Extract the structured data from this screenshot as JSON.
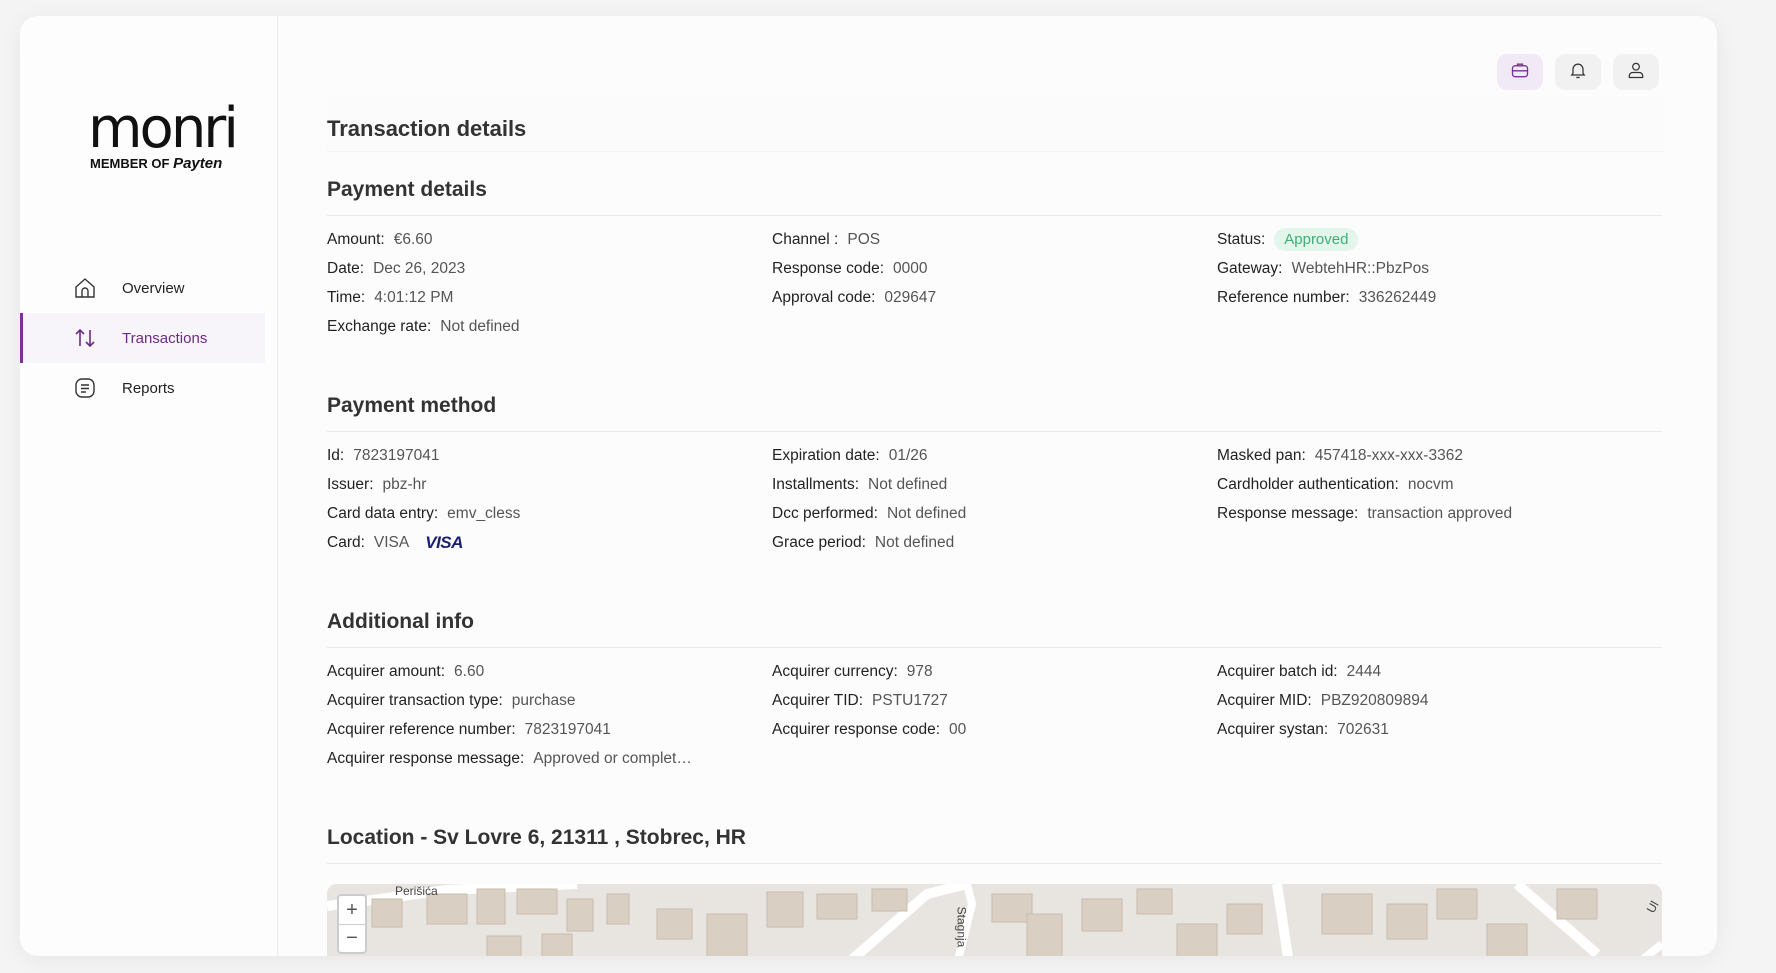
{
  "brand": {
    "logo_text": "monri",
    "member_text": "MEMBER OF",
    "payten_text": "Payten"
  },
  "nav": [
    {
      "label": "Overview",
      "icon": "home-icon"
    },
    {
      "label": "Transactions",
      "icon": "arrows-updown-icon",
      "active": true
    },
    {
      "label": "Reports",
      "icon": "report-icon"
    }
  ],
  "page_title": "Transaction details",
  "payment_details": {
    "title": "Payment details",
    "col1": [
      {
        "label": "Amount:",
        "value": "€6.60"
      },
      {
        "label": "Date:",
        "value": "Dec 26, 2023"
      },
      {
        "label": "Time:",
        "value": "4:01:12 PM"
      },
      {
        "label": "Exchange rate:",
        "value": "Not defined"
      }
    ],
    "col2": [
      {
        "label": "Channel :",
        "value": "POS"
      },
      {
        "label": "Response code:",
        "value": "0000"
      },
      {
        "label": "Approval code:",
        "value": "029647"
      }
    ],
    "col3": [
      {
        "label": "Status:",
        "value": "Approved",
        "badge": true
      },
      {
        "label": "Gateway:",
        "value": "WebtehHR::PbzPos"
      },
      {
        "label": "Reference number:",
        "value": "336262449"
      }
    ]
  },
  "payment_method": {
    "title": "Payment method",
    "col1": [
      {
        "label": "Id:",
        "value": "7823197041"
      },
      {
        "label": "Issuer:",
        "value": "pbz-hr"
      },
      {
        "label": "Card data entry:",
        "value": "emv_cless"
      },
      {
        "label": "Card:",
        "value": "VISA",
        "logo": "VISA"
      }
    ],
    "col2": [
      {
        "label": "Expiration date:",
        "value": "01/26"
      },
      {
        "label": "Installments:",
        "value": "Not defined"
      },
      {
        "label": "Dcc performed:",
        "value": "Not defined"
      },
      {
        "label": "Grace period:",
        "value": "Not defined"
      }
    ],
    "col3": [
      {
        "label": "Masked pan:",
        "value": "457418-xxx-xxx-3362"
      },
      {
        "label": "Cardholder authentication:",
        "value": "nocvm"
      },
      {
        "label": "Response message:",
        "value": "transaction approved"
      }
    ]
  },
  "additional_info": {
    "title": "Additional info",
    "col1": [
      {
        "label": "Acquirer amount:",
        "value": "6.60"
      },
      {
        "label": "Acquirer transaction type:",
        "value": "purchase"
      },
      {
        "label": "Acquirer reference number:",
        "value": "7823197041"
      },
      {
        "label": "Acquirer response message:",
        "value": "Approved or complet…"
      }
    ],
    "col2": [
      {
        "label": "Acquirer currency:",
        "value": "978"
      },
      {
        "label": "Acquirer TID:",
        "value": "PSTU1727"
      },
      {
        "label": "Acquirer response code:",
        "value": "00"
      }
    ],
    "col3": [
      {
        "label": "Acquirer batch id:",
        "value": "2444"
      },
      {
        "label": "Acquirer MID:",
        "value": "PBZ920809894"
      },
      {
        "label": "Acquirer systan:",
        "value": "702631"
      }
    ]
  },
  "location": {
    "title": "Location - Sv Lovre 6, 21311 , Stobrec, HR",
    "zoom_in": "+",
    "zoom_out": "−",
    "street_labels": [
      "Perišića",
      "Stagnja",
      "Ul"
    ]
  },
  "colors": {
    "accent": "#7b3294",
    "approved_bg": "#e3f6ec",
    "approved_text": "#3fae74"
  }
}
